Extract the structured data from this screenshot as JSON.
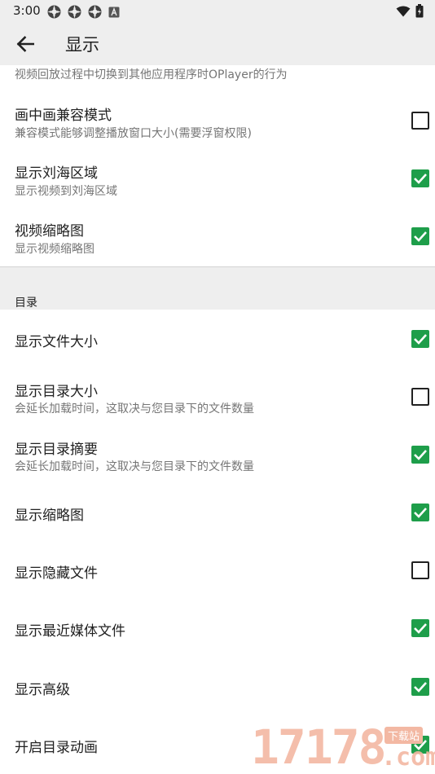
{
  "status_bar": {
    "time": "3:00"
  },
  "app_bar": {
    "title": "显示"
  },
  "partial_summary": "视频回放过程中切换到其他应用程序时OPlayer的行为",
  "group1": [
    {
      "title": "画中画兼容模式",
      "summary": "兼容模式能够调整播放窗口大小(需要浮窗权限)",
      "checked": false
    },
    {
      "title": "显示刘海区域",
      "summary": "显示视频到刘海区域",
      "checked": true
    },
    {
      "title": "视频缩略图",
      "summary": "显示视频缩略图",
      "checked": true
    }
  ],
  "category": {
    "label": "目录"
  },
  "group2": [
    {
      "title": "显示文件大小",
      "summary": "",
      "checked": true
    },
    {
      "title": "显示目录大小",
      "summary": "会延长加载时间，这取决与您目录下的文件数量",
      "checked": false
    },
    {
      "title": "显示目录摘要",
      "summary": "会延长加载时间，这取决与您目录下的文件数量",
      "checked": true
    },
    {
      "title": "显示缩略图",
      "summary": "",
      "checked": true
    },
    {
      "title": "显示隐藏文件",
      "summary": "",
      "checked": false
    },
    {
      "title": "显示最近媒体文件",
      "summary": "",
      "checked": true
    },
    {
      "title": "显示高级",
      "summary": "",
      "checked": true
    },
    {
      "title": "开启目录动画",
      "summary": "",
      "checked": true
    }
  ],
  "watermark": {
    "digits": "17178",
    "tag": "下载站",
    "suffix": ".com"
  },
  "colors": {
    "accent": "#1e9e4a",
    "bar_bg": "#eeeeee"
  }
}
